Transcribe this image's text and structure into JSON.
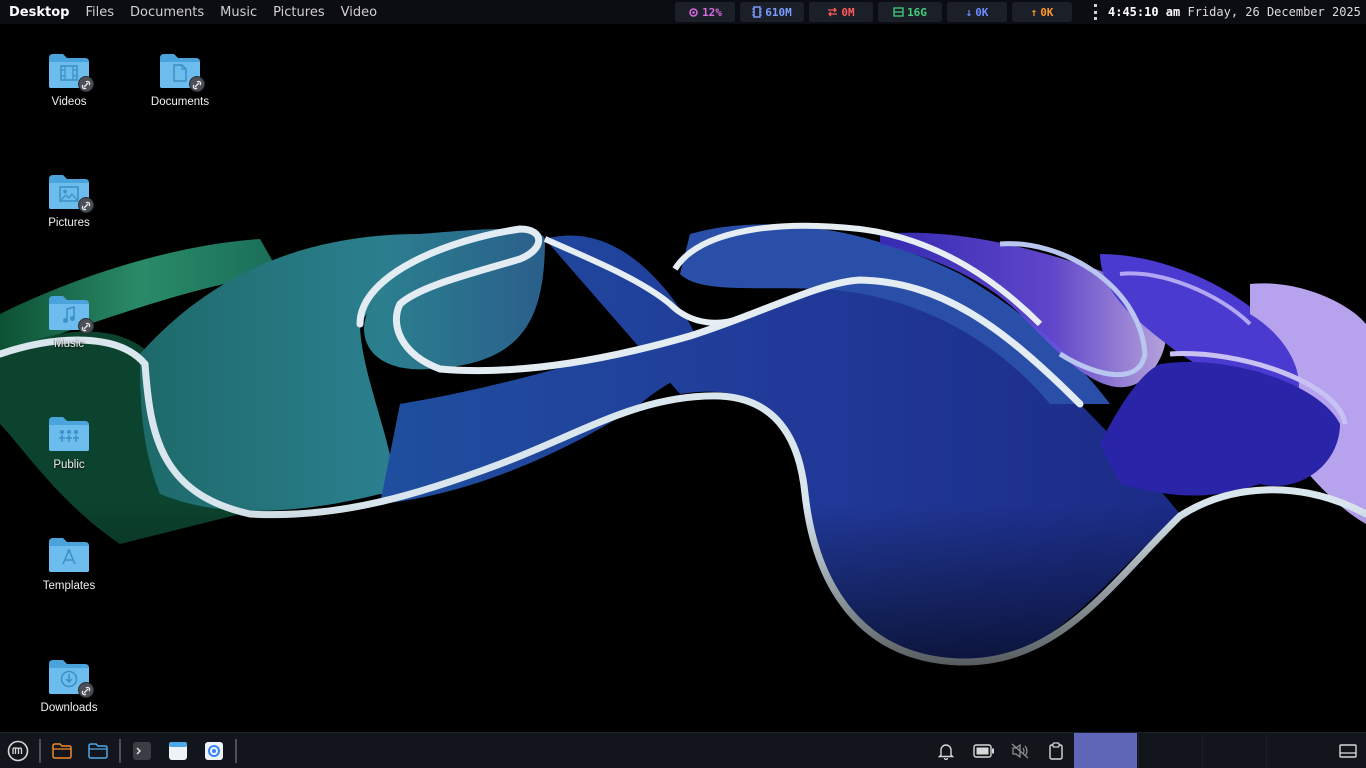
{
  "topbar": {
    "menu": [
      {
        "label": "Desktop",
        "active": true
      },
      {
        "label": "Files",
        "active": false
      },
      {
        "label": "Documents",
        "active": false
      },
      {
        "label": "Music",
        "active": false
      },
      {
        "label": "Pictures",
        "active": false
      },
      {
        "label": "Video",
        "active": false
      }
    ],
    "monitors": {
      "cpu": "12%",
      "memory": "610M",
      "swap": "0M",
      "disk": "16G",
      "download": "0K",
      "upload": "0K"
    },
    "clock": {
      "time": "4:45:10 am",
      "date": "Friday, 26 December 2025"
    }
  },
  "desktop": {
    "icons": [
      {
        "label": "Videos",
        "glyph": "film-icon"
      },
      {
        "label": "Documents",
        "glyph": "document-icon"
      },
      {
        "label": "Pictures",
        "glyph": "image-icon"
      },
      {
        "label": "Music",
        "glyph": "music-note-icon"
      },
      {
        "label": "Public",
        "glyph": "people-icon"
      },
      {
        "label": "Templates",
        "glyph": "compass-icon"
      },
      {
        "label": "Downloads",
        "glyph": "download-icon"
      }
    ]
  },
  "taskbar": {
    "launchers": [
      "mint-menu-icon",
      "files-orange-icon",
      "files-blue-icon",
      "terminal-icon",
      "text-editor-icon",
      "browser-icon"
    ],
    "tray": [
      "notification-bell-icon",
      "battery-icon",
      "volume-muted-icon",
      "clipboard-icon",
      "show-desktop-icon"
    ]
  },
  "colors": {
    "accent": "#5f65b7",
    "folder": "#5fb6ea",
    "topbar_bg": "#0b0d12",
    "taskbar_bg": "#12151b"
  }
}
